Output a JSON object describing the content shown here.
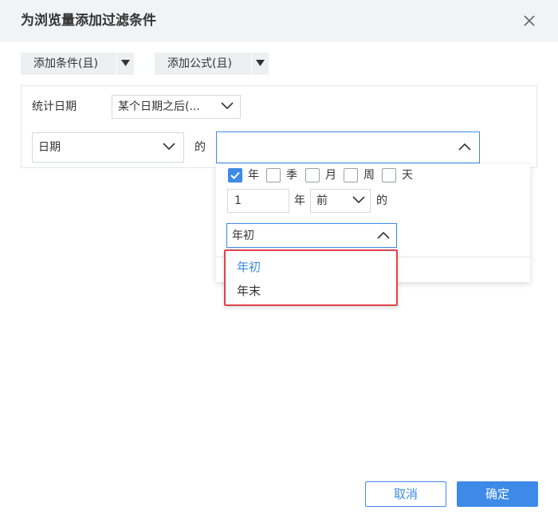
{
  "dialog": {
    "title": "为浏览量添加过滤条件"
  },
  "toolbar": {
    "add_condition_label": "添加条件(且)",
    "add_formula_label": "添加公式(且)"
  },
  "filter": {
    "field_label": "统计日期",
    "operator_value": "某个日期之后(...",
    "dimension_value": "日期",
    "of_label": "的",
    "value_input": ""
  },
  "popup": {
    "units": [
      {
        "label": "年",
        "checked": true
      },
      {
        "label": "季",
        "checked": false
      },
      {
        "label": "月",
        "checked": false
      },
      {
        "label": "周",
        "checked": false
      },
      {
        "label": "天",
        "checked": false
      }
    ],
    "offset_value": "1",
    "offset_unit_label": "年",
    "direction_value": "前",
    "of_label": "的",
    "position_value": "年初",
    "position_options": [
      {
        "label": "年初",
        "selected": true
      },
      {
        "label": "年末",
        "selected": false
      }
    ]
  },
  "footer": {
    "cancel_label": "取消",
    "ok_label": "确定"
  },
  "colors": {
    "accent": "#3d8ae8",
    "highlight_border": "#e0434a",
    "titlebar_bg": "#f2f3f5"
  }
}
